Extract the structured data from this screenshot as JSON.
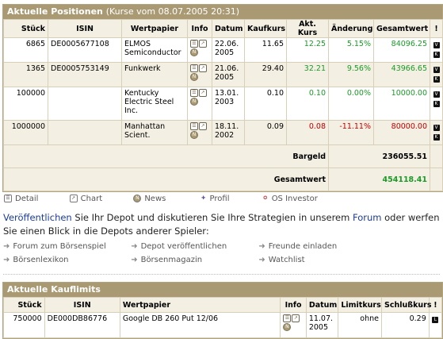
{
  "positions": {
    "title": "Aktuelle Positionen",
    "subtitle": "(Kurse vom 08.07.2005 20:31)",
    "headers": [
      "Stück",
      "ISIN",
      "Wertpapier",
      "Info",
      "Datum",
      "Kaufkurs",
      "Akt. Kurs",
      "Änderung",
      "Gesamtwert",
      "!"
    ],
    "rows": [
      {
        "qty": "6865",
        "isin": "DE0005677108",
        "name": "ELMOS Semiconductor",
        "date": "22.06. 2005",
        "buy": "11.65",
        "cur": "12.25",
        "change": "5.15%",
        "total": "84096.25",
        "trend": "green"
      },
      {
        "qty": "1365",
        "isin": "DE0005753149",
        "name": "Funkwerk",
        "date": "21.06. 2005",
        "buy": "29.40",
        "cur": "32.21",
        "change": "9.56%",
        "total": "43966.65",
        "trend": "green"
      },
      {
        "qty": "100000",
        "isin": "",
        "name": "Kentucky Electric Steel Inc.",
        "date": "13.01. 2003",
        "buy": "0.10",
        "cur": "0.10",
        "change": "0.00%",
        "total": "10000.00",
        "trend": "green"
      },
      {
        "qty": "1000000",
        "isin": "",
        "name": "Manhattan Scient.",
        "date": "18.11. 2002",
        "buy": "0.09",
        "cur": "0.08",
        "change": "-11.11%",
        "total": "80000.00",
        "trend": "red"
      }
    ],
    "bargeld_label": "Bargeld",
    "bargeld_value": "236055.51",
    "gesamtwert_label": "Gesamtwert",
    "gesamtwert_value": "454118.41"
  },
  "legend": [
    "Detail",
    "Chart",
    "News",
    "Profil",
    "OS Investor"
  ],
  "intro": {
    "link1": "Veröffentlichen",
    "text1": " Sie Ihr Depot und diskutieren Sie Ihre Strategien in unserem ",
    "link2": "Forum",
    "text2": " oder werfen Sie einen Blick in die Depots anderer Spieler:"
  },
  "actions": [
    [
      "Forum zum Börsenspiel",
      "Depot veröffentlichen",
      "Freunde einladen"
    ],
    [
      "Börsenlexikon",
      "Börsenmagazin",
      "Watchlist"
    ]
  ],
  "limits": {
    "title": "Aktuelle Kauflimits",
    "headers": [
      "Stück",
      "ISIN",
      "Wertpapier",
      "Info",
      "Datum",
      "Limitkurs",
      "Schlußkurs",
      "!"
    ],
    "rows": [
      {
        "qty": "750000",
        "isin": "DE000DB86776",
        "name": "Google DB 260 Put 12/06",
        "date": "11.07. 2005",
        "limit": "ohne",
        "close": "0.29"
      }
    ]
  },
  "colors": {
    "header": "#a99a73",
    "panel": "#f3efe2",
    "up": "#1b9a27",
    "down": "#c40000",
    "link": "#1a3b9c"
  }
}
